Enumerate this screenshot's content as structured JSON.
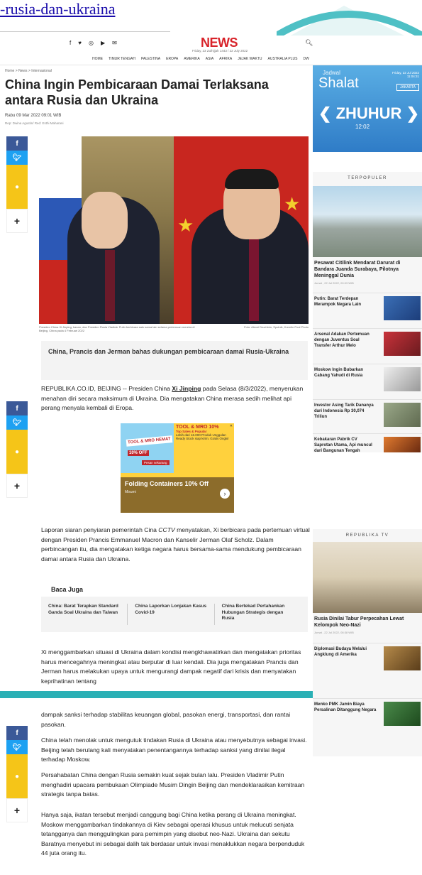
{
  "top_link": "-rusia-dan-ukraina",
  "header": {
    "social": [
      "f",
      "♥",
      "◎",
      "▶",
      "✉"
    ],
    "logo": "NEWS",
    "date": "Friday, 23 Zulhijjah 1443 / 22 July 2022",
    "nav": [
      "HOME",
      "TIMUR TENGAH",
      "PALESTINA",
      "EROPA",
      "AMERIKA",
      "ASIA",
      "AFRIKA",
      "JEJAK WAKTU",
      "AUSTRALIA PLUS",
      "DW"
    ]
  },
  "article": {
    "breadcrumb": "Home > News > Internasional",
    "title": "China Ingin Pembicaraan Damai Terlaksana antara Rusia dan Ukraina",
    "date": "Rabu 09 Mar 2022 09:01 WIB",
    "reporter": "Rep: Dwina Agustin/ Red: Esthi Maharani",
    "caption_left": "Presiden China Xi Jinping, kanan, dan Presiden Rusia Vladimir Putin berbicara satu sama lain selama pertemuan mereka di Beijing, China pada 4 Februari 2022",
    "caption_right": "Foto: Alexei Druzhinin, Sputnik, Kremlin Pool Photo",
    "subhead": "China, Prancis dan Jerman bahas dukungan pembicaraan damai Rusia-Ukraina",
    "p1_a": "REPUBLIKA.CO.ID, BEIJING -- Presiden China ",
    "p1_link": "Xi Jinping",
    "p1_b": " pada Selasa (8/3/2022), menyerukan menahan diri secara maksimum di Ukraina. Dia mengatakan China merasa sedih melihat api perang menyala kembali di Eropa.",
    "p2_a": "Laporan siaran penyiaran pemerintah Cina ",
    "p2_i": "CCTV",
    "p2_b": " menyatakan, Xi berbicara pada pertemuan virtual dengan Presiden Prancis Emmanuel Macron dan Kanselir Jerman Olaf Scholz. Dalam perbincangan itu, dia mengatakan ketiga negara harus bersama-sama mendukung pembicaraan damai antara Rusia dan Ukraina.",
    "baca_title": "Baca Juga",
    "baca": [
      "China: Barat Terapkan Standard Ganda Soal Ukraina dan Taiwan",
      "China Laporkan Lonjakan Kasus Covid-19",
      "China Bertekad Pertahankan Hubungan Strategis dengan Rusia"
    ],
    "p3": "Xi menggambarkan situasi di Ukraina dalam kondisi mengkhawatirkan dan mengatakan prioritas harus mencegahnya meningkat atau berputar di luar kendali. Dia juga mengatakan Prancis dan Jerman harus melakukan upaya untuk mengurangi dampak negatif dari krisis dan menyatakan keprihatinan tentang",
    "p4": "dampak sanksi terhadap stabilitas keuangan global, pasokan energi, transportasi, dan rantai pasokan.",
    "p5": "China telah menolak untuk mengutuk tindakan Rusia di Ukraina atau menyebutnya sebagai invasi. Beijing telah berulang kali menyatakan penentangannya terhadap sanksi yang dinilai ilegal terhadap Moskow.",
    "p6": "Persahabatan China dengan Rusia semakin kuat sejak bulan lalu. Presiden Vladimir Putin menghadiri upacara pembukaan Olimpiade Musim Dingin Beijing dan mendeklarasikan kemitraan strategis tanpa batas.",
    "p7": "Hanya saja, ikatan tersebut menjadi canggung bagi China ketika perang di Ukraina meningkat. Moskow menggambarkan tindakannya di Kiev sebagai operasi khusus untuk melucuti senjata tetangganya dan menggulingkan para pemimpin yang disebut neo-Nazi. Ukraina dan sekutu Baratnya menyebut ini sebagai dalih tak berdasar untuk invasi menaklukkan negara berpenduduk 44 juta orang itu."
  },
  "ad": {
    "hemat": "TOOL & MRO HEMAT",
    "off": "10% OFF",
    "pesan": "Pesan sekarang",
    "right_title": "TOOL & MRO 10%",
    "right_sub": "Top Sales & Popular",
    "right_line": "Lebih dari 16.000 Produk Unggulan Ready Stock siap kirim. Gratis Ongkir",
    "bottom_title": "Folding Containers 10% Off",
    "bottom_brand": "Misumi"
  },
  "sidebar": {
    "jadwal_small": "Jadwal",
    "jadwal_big": "Shalat",
    "jadwal_date": "Friday, 22 Jul 2022 11:04:31",
    "city": "JAKARTA",
    "prayer": "ZHUHUR",
    "time": "12:02",
    "terpopuler": "TERPOPULER",
    "feat_title": "Pesawat Citilink Mendarat Darurat di Bandara Juanda Surabaya, Pilotnya Meninggal Dunia",
    "feat_date": "Jumat , 22 Jul 2022, 00:03 WIB",
    "pop": [
      "Putin: Barat Terdepan Merampok Negara Lain",
      "Arsenal Adakan Pertemuan dengan Juventus Soal Transfer Arthur Melo",
      "Moskow Ingin Bubarkan Cabang Yahudi di Rusia",
      "Investor Asing Tarik Dananya dari Indonesia Rp 30,074 Triliun",
      "Kebakaran Pabrik CV Saprotan Utama, Api muncul dari Bangunan Tengah"
    ],
    "tv": "REPUBLIKA TV",
    "tv_title": "Rusia Dinilai Tabur Perpecahan Lewat Kelompok Neo-Nazi",
    "tv_date": "Jumat , 22 Jul 2022, 08:38 WIB",
    "tv_items": [
      "Diplomasi Budaya Melalui Angklung di Amerika",
      "Menko PMK Jamin Biaya Persalinan Ditanggung Negara"
    ]
  },
  "colors": {
    "accent_red": "#d8232a",
    "facebook": "#3b5998",
    "twitter": "#1da1f2",
    "whatsapp": "#f5c518",
    "teal": "#2ab0b5"
  }
}
